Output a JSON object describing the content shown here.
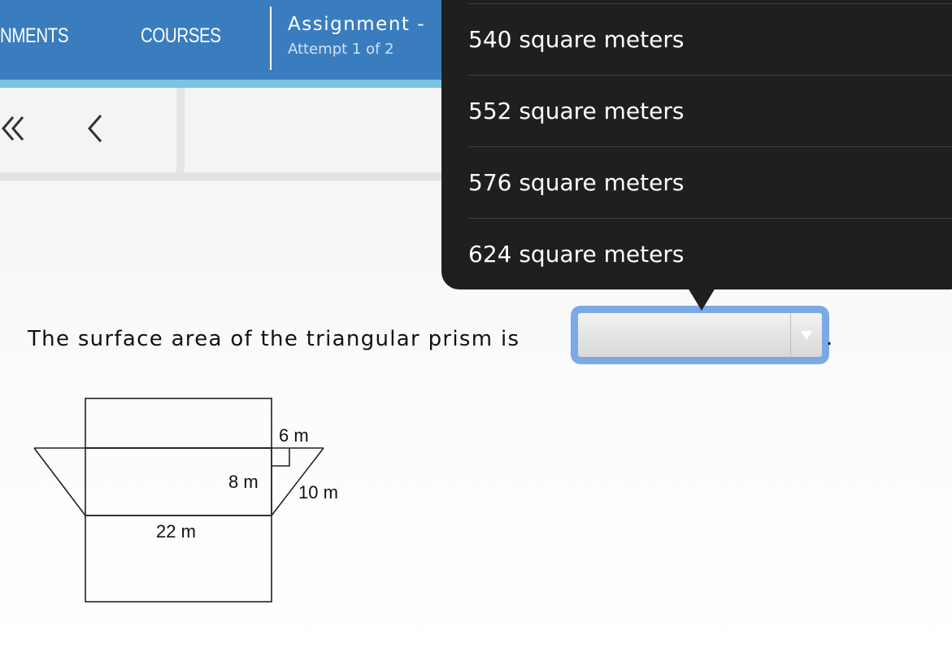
{
  "nav": {
    "assignments_label": "NMENTS",
    "courses_label": "COURSES",
    "assignment_title": "Assignment",
    "title_suffix": "-",
    "attempt": "Attempt 1 of 2"
  },
  "toolbar": {
    "first_icon": "double-chevron-left-icon",
    "prev_icon": "chevron-left-icon"
  },
  "question": {
    "text": "The surface area of the triangular prism is",
    "select_value": "",
    "period": "."
  },
  "dropdown": {
    "options": [
      "540 square meters",
      "552 square meters",
      "576 square meters",
      "624 square meters"
    ]
  },
  "figure": {
    "labels": {
      "top": "6 m",
      "height": "8 m",
      "slant": "10 m",
      "length": "22 m"
    }
  },
  "colors": {
    "header_blue": "#3a7dbf",
    "header_stripe": "#7cc4e6",
    "dropdown_bg": "#1f1f1f",
    "select_border": "#7aa9e6"
  }
}
